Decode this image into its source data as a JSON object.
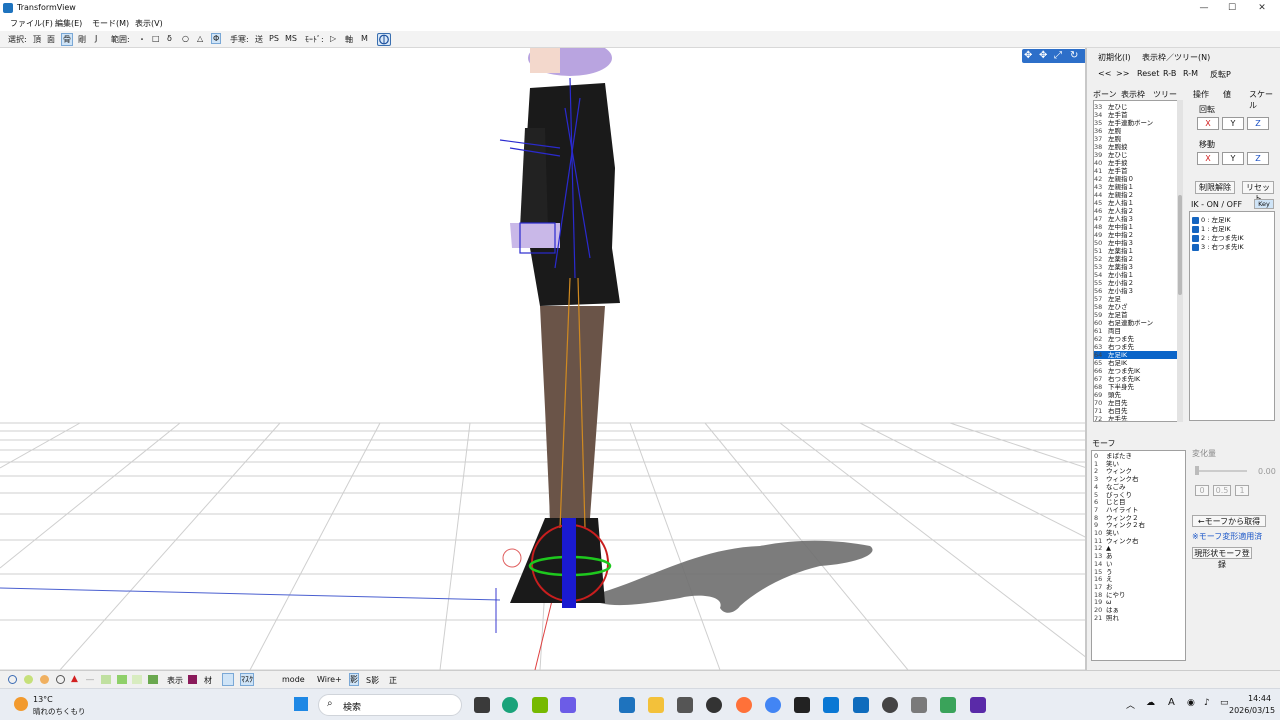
{
  "window": {
    "title": "TransformView"
  },
  "menu": [
    "ファイル(F)",
    "編集(E)",
    "モード(M)",
    "表示(V)"
  ],
  "toolbar": {
    "select_label": "選択:",
    "select_items": [
      "頂",
      "面",
      "骨",
      "剛",
      "J"
    ],
    "range_label": "範囲:",
    "range_items": [
      "・",
      "□",
      "δ",
      "○",
      "△",
      "Φ"
    ],
    "handle_label": "手寒:",
    "handle_items": [
      "送",
      "PS",
      "MS"
    ],
    "mode_label": "ﾓｰﾄﾞ:",
    "mode_items": [
      "▷",
      "軸",
      "M"
    ]
  },
  "right_panel": {
    "init_menu": "初期化(I)",
    "display_menu": "表示枠／ツリー(N)",
    "nav_prev": "<<",
    "nav_next": ">>",
    "reset": "Reset",
    "rb": "R-B",
    "rm": "R-M",
    "flip": "反転P",
    "tabs": [
      "ボーン",
      "表示枠",
      "ツリー"
    ],
    "op_tabs": [
      "操作",
      "値",
      "スケール"
    ],
    "rotation_label": "回転",
    "translation_label": "移動",
    "axes": [
      "X",
      "Y",
      "Z"
    ],
    "delete_limit": "制限解除",
    "reset_btn": "リセット",
    "ik_label": "IK - ON / OFF",
    "key_btn": "Key",
    "ik_items": [
      "0 : 左足IK",
      "1 : 右足IK",
      "2 : 左つま先IK",
      "3 : 右つま先IK"
    ],
    "bones": [
      {
        "n": "33",
        "name": "左ひじ"
      },
      {
        "n": "34",
        "name": "左手首"
      },
      {
        "n": "35",
        "name": "左手連動ボーン"
      },
      {
        "n": "36",
        "name": "左腕"
      },
      {
        "n": "37",
        "name": "左腕"
      },
      {
        "n": "38",
        "name": "左腕捩"
      },
      {
        "n": "39",
        "name": "左ひじ"
      },
      {
        "n": "40",
        "name": "左手捩"
      },
      {
        "n": "41",
        "name": "左手首"
      },
      {
        "n": "42",
        "name": "左親指０"
      },
      {
        "n": "43",
        "name": "左親指１"
      },
      {
        "n": "44",
        "name": "左親指２"
      },
      {
        "n": "45",
        "name": "左人指１"
      },
      {
        "n": "46",
        "name": "左人指２"
      },
      {
        "n": "47",
        "name": "左人指３"
      },
      {
        "n": "48",
        "name": "左中指１"
      },
      {
        "n": "49",
        "name": "左中指２"
      },
      {
        "n": "50",
        "name": "左中指３"
      },
      {
        "n": "51",
        "name": "左薬指１"
      },
      {
        "n": "52",
        "name": "左薬指２"
      },
      {
        "n": "53",
        "name": "左薬指３"
      },
      {
        "n": "54",
        "name": "左小指１"
      },
      {
        "n": "55",
        "name": "左小指２"
      },
      {
        "n": "56",
        "name": "左小指３"
      },
      {
        "n": "57",
        "name": "左足"
      },
      {
        "n": "58",
        "name": "左ひざ"
      },
      {
        "n": "59",
        "name": "左足首"
      },
      {
        "n": "60",
        "name": "右足連動ボーン"
      },
      {
        "n": "61",
        "name": "両目"
      },
      {
        "n": "62",
        "name": "左つま先"
      },
      {
        "n": "63",
        "name": "右つま先"
      },
      {
        "n": "64",
        "name": "左足IK"
      },
      {
        "n": "65",
        "name": "右足IK"
      },
      {
        "n": "66",
        "name": "左つま先IK"
      },
      {
        "n": "67",
        "name": "右つま先IK"
      },
      {
        "n": "68",
        "name": "下半身先"
      },
      {
        "n": "69",
        "name": "頭先"
      },
      {
        "n": "70",
        "name": "左目先"
      },
      {
        "n": "71",
        "name": "右目先"
      },
      {
        "n": "72",
        "name": "左手先"
      }
    ],
    "selected_bone_index": 31,
    "morph_label": "モーフ",
    "change_amount_label": "変化量",
    "change_value": "0.00",
    "preset_values": [
      "0",
      "0.5",
      "1"
    ],
    "from_morph_btn": "←モーフから取得",
    "morph_warning": "※モーフ変形適用済",
    "register_btn": "現形状モーフ登録",
    "morphs": [
      {
        "n": "0",
        "name": "まばたき"
      },
      {
        "n": "1",
        "name": "笑い"
      },
      {
        "n": "2",
        "name": "ウィンク"
      },
      {
        "n": "3",
        "name": "ウィンク右"
      },
      {
        "n": "4",
        "name": "なごみ"
      },
      {
        "n": "5",
        "name": "びっくり"
      },
      {
        "n": "6",
        "name": "じと目"
      },
      {
        "n": "7",
        "name": "ハイライト"
      },
      {
        "n": "8",
        "name": "ウィンク２"
      },
      {
        "n": "9",
        "name": "ウィンク２右"
      },
      {
        "n": "10",
        "name": "笑い"
      },
      {
        "n": "11",
        "name": "ウィンク右"
      },
      {
        "n": "12",
        "name": "▲"
      },
      {
        "n": "13",
        "name": "あ"
      },
      {
        "n": "14",
        "name": "い"
      },
      {
        "n": "15",
        "name": "う"
      },
      {
        "n": "16",
        "name": "え"
      },
      {
        "n": "17",
        "name": "お"
      },
      {
        "n": "18",
        "name": "にやり"
      },
      {
        "n": "19",
        "name": "ω"
      },
      {
        "n": "20",
        "name": "はぁ"
      },
      {
        "n": "21",
        "name": "照れ"
      }
    ]
  },
  "bottombar": {
    "items": [
      "表示",
      "材",
      "ﾏｽｸ",
      "mode",
      "Wire+",
      "影",
      "S影",
      "正"
    ]
  },
  "taskbar": {
    "weather_temp": "13°C",
    "weather_text": "晴れのちくもり",
    "search_placeholder": "検索",
    "time": "14:44",
    "date": "2026/03/15",
    "ime": "A"
  },
  "colors": {
    "accent": "#0a64c8",
    "rotation_x": "#d22020",
    "grid": "#c8c8c8"
  }
}
